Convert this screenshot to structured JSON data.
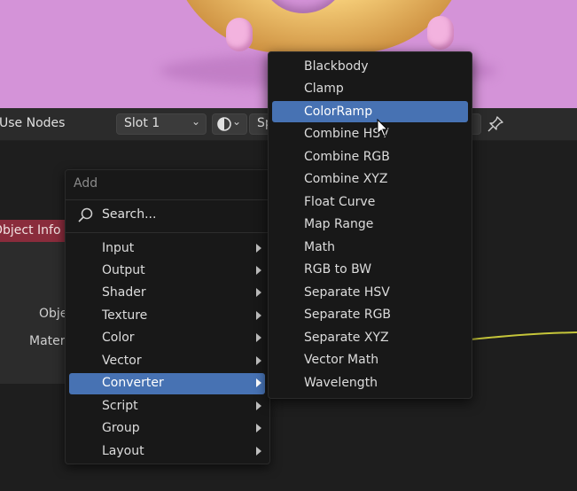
{
  "header": {
    "use_nodes_label": "Use Nodes",
    "slot_dropdown": "Slot 1",
    "partial_label": "Sp"
  },
  "node": {
    "title": "Object Info",
    "socket_object": "Object",
    "socket_material": "Material"
  },
  "add_menu": {
    "title": "Add",
    "search_label": "Search...",
    "categories": [
      {
        "label": "Input"
      },
      {
        "label": "Output"
      },
      {
        "label": "Shader"
      },
      {
        "label": "Texture"
      },
      {
        "label": "Color"
      },
      {
        "label": "Vector"
      },
      {
        "label": "Converter",
        "active": true
      },
      {
        "label": "Script"
      },
      {
        "label": "Group"
      },
      {
        "label": "Layout"
      }
    ]
  },
  "converter_menu": {
    "items": [
      {
        "label": "Blackbody"
      },
      {
        "label": "Clamp"
      },
      {
        "label": "ColorRamp",
        "active": true
      },
      {
        "label": "Combine HSV"
      },
      {
        "label": "Combine RGB"
      },
      {
        "label": "Combine XYZ"
      },
      {
        "label": "Float Curve"
      },
      {
        "label": "Map Range"
      },
      {
        "label": "Math"
      },
      {
        "label": "RGB to BW"
      },
      {
        "label": "Separate HSV"
      },
      {
        "label": "Separate RGB"
      },
      {
        "label": "Separate XYZ"
      },
      {
        "label": "Vector Math"
      },
      {
        "label": "Wavelength"
      }
    ]
  },
  "icons": {
    "search": "search-icon",
    "pin": "pin-icon",
    "viewport_shading": "shading-icon"
  },
  "colors": {
    "highlight": "#4772b3",
    "node_header": "#8a2c3c",
    "link": "#c6c63a"
  }
}
